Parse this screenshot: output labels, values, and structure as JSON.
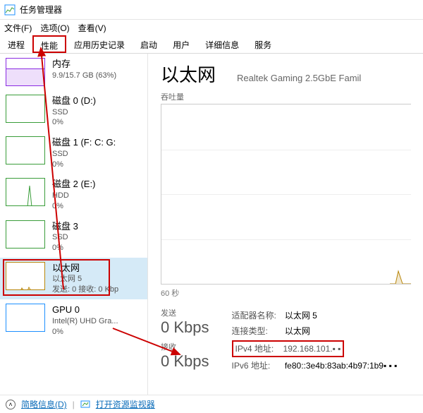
{
  "window": {
    "title": "任务管理器"
  },
  "menu": {
    "file": "文件(F)",
    "options": "选项(O)",
    "view": "查看(V)"
  },
  "tabs": [
    "进程",
    "性能",
    "应用历史记录",
    "启动",
    "用户",
    "详细信息",
    "服务"
  ],
  "activeTab": 1,
  "sidebar": [
    {
      "kind": "mem",
      "t1": "内存",
      "t2": "9.9/15.7 GB (63%)",
      "t3": ""
    },
    {
      "kind": "disk",
      "t1": "磁盘 0 (D:)",
      "t2": "SSD",
      "t3": "0%"
    },
    {
      "kind": "disk",
      "t1": "磁盘 1 (F: C: G:",
      "t2": "SSD",
      "t3": "0%"
    },
    {
      "kind": "disk",
      "t1": "磁盘 2 (E:)",
      "t2": "HDD",
      "t3": "0%"
    },
    {
      "kind": "disk",
      "t1": "磁盘 3",
      "t2": "SSD",
      "t3": "0%"
    },
    {
      "kind": "net",
      "t1": "以太网",
      "t2": "以太网 5",
      "t3": "发送: 0 接收: 0 Kbp"
    },
    {
      "kind": "gpu",
      "t1": "GPU 0",
      "t2": "Intel(R) UHD Gra...",
      "t3": "0%"
    }
  ],
  "main": {
    "title": "以太网",
    "subtitle": "Realtek Gaming 2.5GbE Famil",
    "chartLabel": "吞吐量",
    "timeLabel": "60 秒",
    "send": {
      "lbl": "发送",
      "val": "0 Kbps"
    },
    "recv": {
      "lbl": "接收",
      "val": "0 Kbps"
    },
    "info": {
      "adapterLbl": "适配器名称:",
      "adapter": "以太网 5",
      "connLbl": "连接类型:",
      "conn": "以太网",
      "ipv4Lbl": "IPv4 地址:",
      "ipv4": "192.168.101.▪ ▪",
      "ipv6Lbl": "IPv6 地址:",
      "ipv6": "fe80::3e4b:83ab:4b97:1b9▪ ▪ ▪"
    }
  },
  "footer": {
    "less": "简略信息(D)",
    "mon": "打开资源监视器"
  }
}
